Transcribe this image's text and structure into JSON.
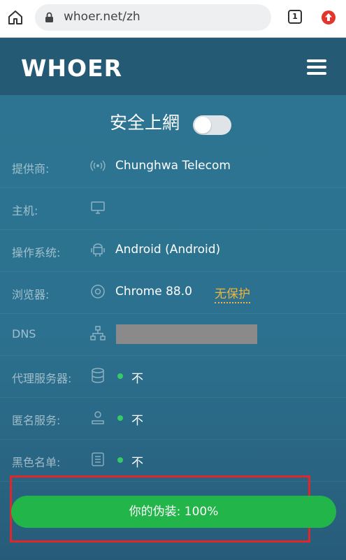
{
  "browser": {
    "url": "whoer.net/zh",
    "tab_count": "1"
  },
  "site": {
    "logo": "WHOER"
  },
  "safe_browsing": {
    "label": "安全上網",
    "enabled": false
  },
  "rows": [
    {
      "label": "提供商:",
      "icon": "signal-icon",
      "value": "Chunghwa Telecom"
    },
    {
      "label": "主机:",
      "icon": "monitor-icon",
      "value": ""
    },
    {
      "label": "操作系统:",
      "icon": "android-icon",
      "value": "Android (Android)"
    },
    {
      "label": "浏览器:",
      "icon": "chrome-icon",
      "value": "Chrome 88.0",
      "warning": "无保护"
    },
    {
      "label": "DNS",
      "icon": "network-icon",
      "value": ""
    },
    {
      "label": "代理服务器:",
      "icon": "database-icon",
      "status": "不"
    },
    {
      "label": "匿名服务:",
      "icon": "user-icon",
      "status": "不"
    },
    {
      "label": "黑色名单:",
      "icon": "list-icon",
      "status": "不"
    }
  ],
  "disguise": {
    "label": "你的伪装: 100%"
  },
  "colors": {
    "page_bg": "#2c7290",
    "header_bg": "#245a74",
    "accent_green": "#22b54a",
    "warning_orange": "#f0b43c",
    "highlight_red": "#e0262a"
  }
}
